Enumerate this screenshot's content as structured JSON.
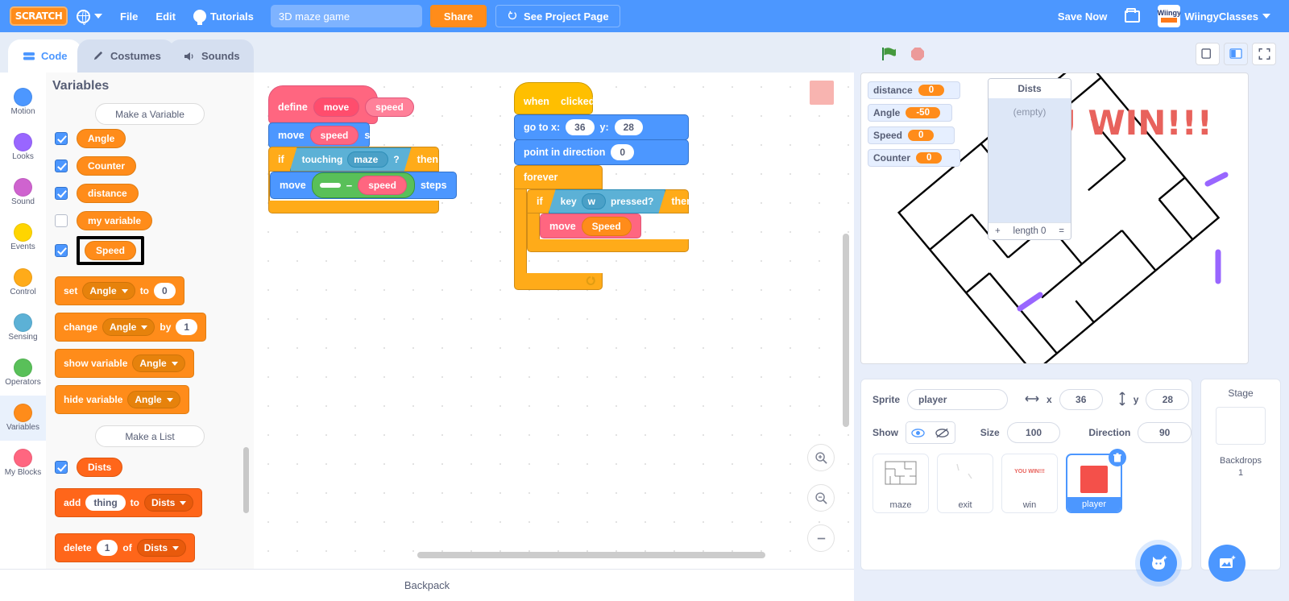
{
  "menubar": {
    "logo_text": "SCRATCH",
    "globe_icon": "globe-icon",
    "file_label": "File",
    "edit_label": "Edit",
    "tutorials_label": "Tutorials",
    "tutorials_icon": "lightbulb-icon",
    "project_title": "3D maze game",
    "project_title_placeholder": "Project title",
    "share_label": "Share",
    "see_project_label": "See Project Page",
    "see_project_icon": "project-page-icon",
    "save_now_label": "Save Now",
    "folder_icon": "folder-icon",
    "avatar_icon": "wiingy-avatar",
    "avatar_text_top": "Wiingy",
    "username": "WiingyClasses",
    "user_caret_icon": "chevron-down-icon",
    "accent_blue": "#4c97ff",
    "accent_orange": "#ff8c1a"
  },
  "tabs": [
    {
      "label": "Code",
      "icon": "code-icon",
      "active": true
    },
    {
      "label": "Costumes",
      "icon": "paintbrush-icon",
      "active": false
    },
    {
      "label": "Sounds",
      "icon": "speaker-icon",
      "active": false
    }
  ],
  "categories": [
    {
      "label": "Motion",
      "color": "#4c97ff",
      "selected": false
    },
    {
      "label": "Looks",
      "color": "#9966ff",
      "selected": false
    },
    {
      "label": "Sound",
      "color": "#cf63cf",
      "selected": false
    },
    {
      "label": "Events",
      "color": "#ffd500",
      "selected": false
    },
    {
      "label": "Control",
      "color": "#ffab19",
      "selected": false
    },
    {
      "label": "Sensing",
      "color": "#5cb1d6",
      "selected": false
    },
    {
      "label": "Operators",
      "color": "#59c059",
      "selected": false
    },
    {
      "label": "Variables",
      "color": "#ff8c1a",
      "selected": true
    },
    {
      "label": "My Blocks",
      "color": "#ff6680",
      "selected": false
    }
  ],
  "palette": {
    "title": "Variables",
    "make_variable_label": "Make a Variable",
    "make_list_label": "Make a List",
    "variables": [
      {
        "name": "Angle",
        "checked": true,
        "highlighted": false
      },
      {
        "name": "Counter",
        "checked": true,
        "highlighted": false
      },
      {
        "name": "distance",
        "checked": true,
        "highlighted": false
      },
      {
        "name": "my variable",
        "checked": false,
        "highlighted": false
      },
      {
        "name": "Speed",
        "checked": true,
        "highlighted": true
      }
    ],
    "lists": [
      {
        "name": "Dists",
        "checked": true
      }
    ],
    "blocks": {
      "set_label": "set",
      "set_var": "Angle",
      "set_to": "to",
      "set_value": "0",
      "change_label": "change",
      "change_var": "Angle",
      "change_by": "by",
      "change_value": "1",
      "show_variable_label": "show variable",
      "show_variable_var": "Angle",
      "hide_variable_label": "hide variable",
      "hide_variable_var": "Angle",
      "add_label": "add",
      "add_thing": "thing",
      "add_to": "to",
      "add_list": "Dists",
      "delete_label": "delete",
      "delete_index": "1",
      "delete_of": "of",
      "delete_list": "Dists"
    }
  },
  "scripts": {
    "define_script": {
      "define_label": "define",
      "proc_name": "move",
      "proc_arg": "speed",
      "move_label": "move",
      "move_arg": "speed",
      "steps_label": "steps",
      "if_label": "if",
      "touching_label": "touching",
      "touching_target": "maze",
      "touching_q": "?",
      "then_label": "then",
      "inner_move_label": "move",
      "inner_empty": "",
      "inner_operator": "−",
      "inner_arg": "speed",
      "inner_steps_label": "steps"
    },
    "flag_script": {
      "when_label": "when",
      "flag_icon": "green-flag-icon",
      "clicked_label": "clicked",
      "goto_label": "go to x:",
      "goto_x": "36",
      "goto_y_label": "y:",
      "goto_y": "28",
      "point_label": "point in direction",
      "point_value": "0",
      "forever_label": "forever",
      "if_label": "if",
      "key_label": "key",
      "key_value": "w",
      "pressed_label": "pressed?",
      "then_label": "then",
      "move_label": "move",
      "move_arg": "Speed"
    }
  },
  "canvas_controls": {
    "zoom_in_icon": "zoom-in-icon",
    "zoom_out_icon": "zoom-out-icon",
    "zoom_reset_icon": "zoom-reset-icon"
  },
  "backpack": {
    "label": "Backpack"
  },
  "stage_controls": {
    "green_flag_icon": "green-flag-icon",
    "stop_icon": "stop-sign-icon",
    "small_stage_icon": "small-stage-icon",
    "large_stage_icon": "large-stage-icon",
    "fullscreen_icon": "fullscreen-icon"
  },
  "stage": {
    "monitors": [
      {
        "name": "distance",
        "value": "0"
      },
      {
        "name": "Angle",
        "value": "-50"
      },
      {
        "name": "Speed",
        "value": "0"
      },
      {
        "name": "Counter",
        "value": "0"
      }
    ],
    "list_monitor": {
      "name": "Dists",
      "empty_text": "(empty)",
      "length_label": "length 0",
      "add_icon": "plus-icon",
      "resize_icon": "resize-icon"
    },
    "win_text": "YOU WIN!!!",
    "maze_line_color": "#000000",
    "exit_color": "#9966ff",
    "player_color": "#f4504a"
  },
  "sprite_info": {
    "sprite_label": "Sprite",
    "sprite_name": "player",
    "x_label": "x",
    "x_value": "36",
    "y_label": "y",
    "y_value": "28",
    "x_icon": "horizontal-arrows-icon",
    "y_icon": "vertical-arrows-icon",
    "show_label": "Show",
    "show_icon": "eye-icon",
    "hide_icon": "eye-slash-icon",
    "size_label": "Size",
    "size_value": "100",
    "direction_label": "Direction",
    "direction_value": "90"
  },
  "sprites": [
    {
      "name": "maze",
      "selected": false,
      "thumb": "maze-thumb"
    },
    {
      "name": "exit",
      "selected": false,
      "thumb": "exit-thumb"
    },
    {
      "name": "win",
      "selected": false,
      "thumb": "win-thumb",
      "thumb_text": "YOU WIN!!!"
    },
    {
      "name": "player",
      "selected": true,
      "thumb": "player-thumb"
    }
  ],
  "stage_column": {
    "header": "Stage",
    "backdrops_label": "Backdrops",
    "backdrops_count": "1"
  },
  "fabs": {
    "add_sprite_icon": "add-sprite-cat-icon",
    "add_backdrop_icon": "add-backdrop-icon"
  }
}
